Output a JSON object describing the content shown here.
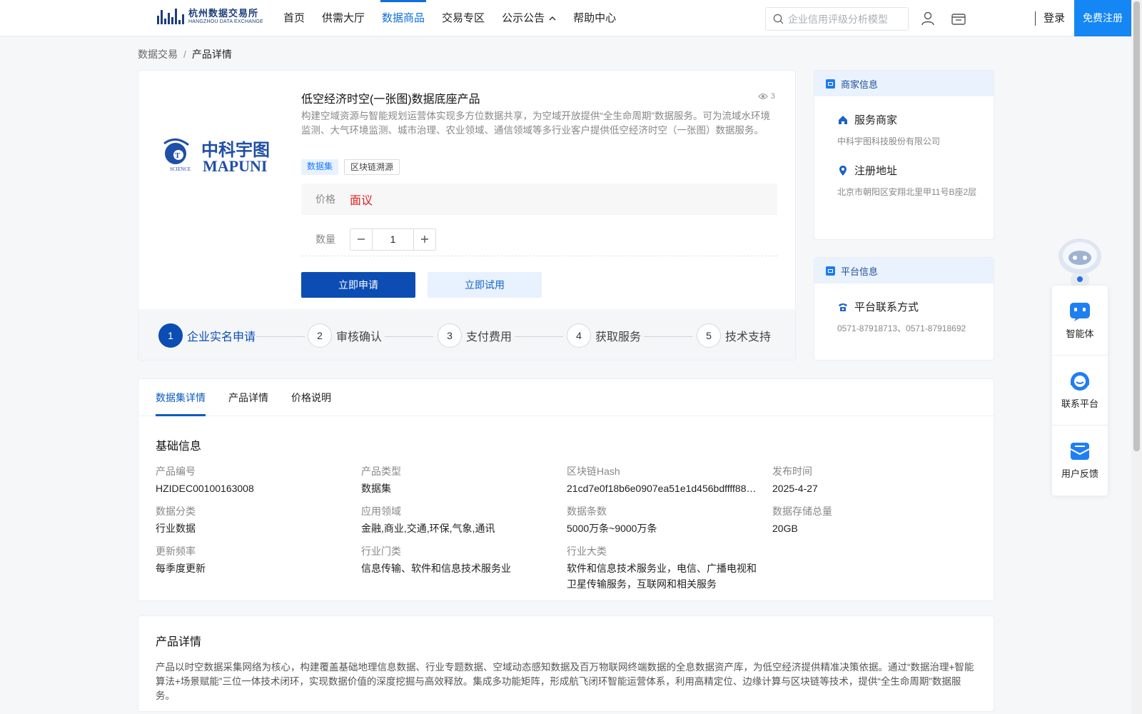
{
  "header": {
    "logo_cn": "杭州数据交易所",
    "logo_en": "HANGZHOU DATA EXCHANGE",
    "nav": [
      {
        "label": "首页"
      },
      {
        "label": "供需大厅"
      },
      {
        "label": "数据商品"
      },
      {
        "label": "交易专区"
      },
      {
        "label": "公示公告"
      },
      {
        "label": "帮助中心"
      }
    ],
    "active_nav": "数据商品",
    "search_placeholder": "企业信用评级分析模型",
    "login": "登录",
    "register": "免费注册",
    "accent": "#1487f5"
  },
  "breadcrumb": {
    "parent": "数据交易",
    "separator": "/",
    "current": "产品详情"
  },
  "product": {
    "brand_cn": "中科宇图",
    "brand_en": "MAPUNI",
    "brand_sub": "SCIENCE",
    "title": "低空经济时空(一张图)数据底座产品",
    "views": "3",
    "description": "构建空域资源与智能规划运营体实现多方位数据共享，为空域开放提供“全生命周期”数据服务。可为流域水环境监测、大气环境监测、城市治理、农业领域、通信领域等多行业客户提供低空经济时空（一张图）数据服务。",
    "tags": [
      "数据集",
      "区块链溯源"
    ],
    "price_label": "价格",
    "price_value": "面议",
    "qty_label": "数量",
    "qty_value": "1",
    "apply_label": "立即申请",
    "trial_label": "立即试用",
    "price_color": "#e02020"
  },
  "steps": [
    {
      "num": "1",
      "label": "企业实名申请"
    },
    {
      "num": "2",
      "label": "审核确认"
    },
    {
      "num": "3",
      "label": "支付费用"
    },
    {
      "num": "4",
      "label": "获取服务"
    },
    {
      "num": "5",
      "label": "技术支持"
    }
  ],
  "merchant": {
    "title": "商家信息",
    "service_label": "服务商家",
    "service_value": "中科宇图科技股份有限公司",
    "address_label": "注册地址",
    "address_value": "北京市朝阳区安翔北里甲11号B座2层"
  },
  "platform": {
    "title": "平台信息",
    "contact_label": "平台联系方式",
    "contact_value": "0571-87918713、0571-87918692"
  },
  "float_bar": {
    "agent": "智能体",
    "contact": "联系平台",
    "feedback": "用户反馈"
  },
  "detail": {
    "tabs": [
      "数据集详情",
      "产品详情",
      "价格说明"
    ],
    "section_title": "基础信息",
    "fields": [
      {
        "k": "产品编号",
        "v": "HZIDEC00100163008"
      },
      {
        "k": "产品类型",
        "v": "数据集"
      },
      {
        "k": "区块链Hash",
        "v": "21cd7e0f18b6e0907ea51e1d456bdffff883..."
      },
      {
        "k": "发布时间",
        "v": "2025-4-27"
      },
      {
        "k": "数据分类",
        "v": "行业数据"
      },
      {
        "k": "应用领域",
        "v": "金融,商业,交通,环保,气象,通讯"
      },
      {
        "k": "数据条数",
        "v": "5000万条~9000万条"
      },
      {
        "k": "数据存储总量",
        "v": "20GB"
      },
      {
        "k": "更新频率",
        "v": "每季度更新"
      },
      {
        "k": "行业门类",
        "v": "信息传输、软件和信息技术服务业"
      },
      {
        "k": "行业大类",
        "v": "软件和信息技术服务业，电信、广播电视和卫星传输服务，互联网和相关服务"
      }
    ]
  },
  "product_detail": {
    "title": "产品详情",
    "text": "产品以时空数据采集网络为核心，构建覆盖基础地理信息数据、行业专题数据、空域动态感知数据及百万物联网终端数据的全息数据资产库，为低空经济提供精准决策依据。通过“数据治理+智能算法+场景赋能”三位一体技术闭环，实现数据价值的深度挖掘与高效释放。集成多功能矩阵，形成航飞闭环智能运营体系，利用高精定位、边缘计算与区块链等技术，提供“全生命周期”数据服务。"
  }
}
